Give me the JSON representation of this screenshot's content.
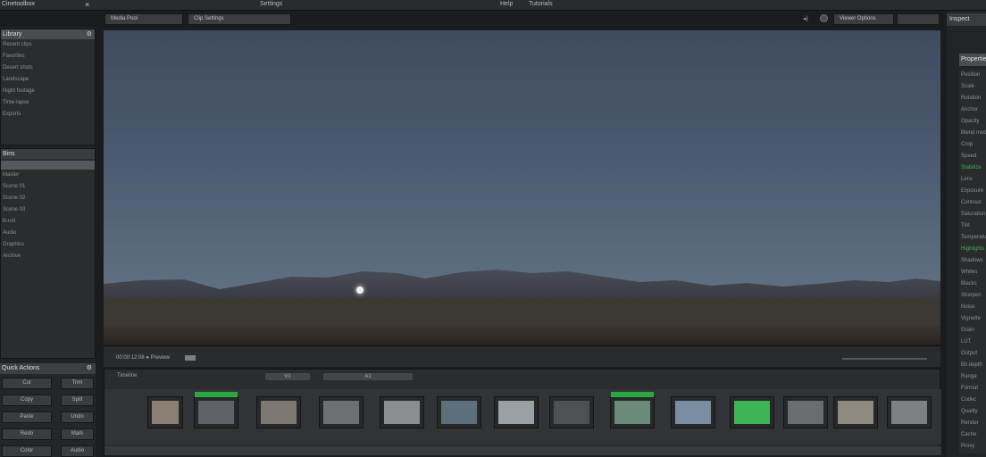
{
  "window": {
    "title": "Cinetoolbox",
    "menus": [
      "Settings",
      "Help",
      "Tutorials"
    ]
  },
  "toolbar": {
    "left_label": "Media Pool",
    "center_label": "Clip   Settings",
    "right_label": "Viewer Options"
  },
  "left_panel": {
    "box1": {
      "title": "Library",
      "rows": [
        "Recent clips",
        "Favorites",
        "Desert shots",
        "Landscape",
        "Night footage",
        "Time-lapse",
        "Exports"
      ]
    },
    "box2": {
      "title": "Bins",
      "rows": [
        "Master",
        "Scene 01",
        "Scene 02",
        "Scene 03",
        "B-roll",
        "Audio",
        "Graphics",
        "Archive"
      ]
    },
    "grid": {
      "title": "Quick Actions",
      "buttons": [
        "Cut",
        "Trim",
        "Copy",
        "Split",
        "Paste",
        "Undo",
        "Redo",
        "Mark",
        "Color",
        "Audio"
      ]
    }
  },
  "viewer": {
    "status_label": "00:00:12:08  ● Preview",
    "scene": {
      "sky_top": "#3f4b60",
      "sky_bottom": "#677786",
      "mountain": "#3a3d45",
      "ground": "#2c2623"
    }
  },
  "timeline": {
    "label": "Timeline",
    "tabs": [
      "V1",
      "A1"
    ],
    "clips": [
      {
        "accent": false,
        "tint": "#8a7f72"
      },
      {
        "accent": true,
        "tint": "#5f6266"
      },
      {
        "accent": false,
        "tint": "#7d7872"
      },
      {
        "accent": false,
        "tint": "#6e6f72"
      },
      {
        "accent": false,
        "tint": "#8a8d90"
      },
      {
        "accent": false,
        "tint": "#5d6f7a"
      },
      {
        "accent": false,
        "tint": "#9ba0a4"
      },
      {
        "accent": false,
        "tint": "#4e5154"
      },
      {
        "accent": true,
        "tint": "#6c8a7a"
      },
      {
        "accent": false,
        "tint": "#7a8ea3"
      },
      {
        "accent": false,
        "tint": "#3fb456"
      },
      {
        "accent": false,
        "tint": "#6a6d70"
      },
      {
        "accent": false,
        "tint": "#8f8a80"
      },
      {
        "accent": false,
        "tint": "#7e8083"
      }
    ]
  },
  "right_panel": {
    "top_label": "Inspect",
    "header": "Properties",
    "rows": [
      "Position",
      "Scale",
      "Rotation",
      "Anchor",
      "Opacity",
      "Blend mode",
      "Crop",
      "Speed",
      "Stabilize",
      "Lens",
      "Exposure",
      "Contrast",
      "Saturation",
      "Tint",
      "Temperature",
      "Highlights",
      "Shadows",
      "Whites",
      "Blacks",
      "Sharpen",
      "Noise",
      "Vignette",
      "Grain",
      "LUT",
      "Output",
      "Bit depth",
      "Range",
      "Format",
      "Codec",
      "Quality",
      "Render",
      "Cache",
      "Proxy"
    ],
    "accent_rows": [
      8,
      15
    ]
  }
}
